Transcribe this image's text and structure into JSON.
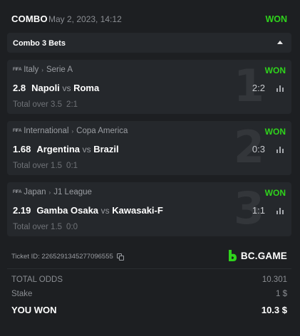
{
  "header": {
    "title": "COMBO",
    "date": "May 2, 2023, 14:12",
    "status": "WON",
    "status_color": "#2fd31c"
  },
  "combo_bar": {
    "label": "Combo 3 Bets",
    "toggle_icon": "caret-up-icon"
  },
  "bets": [
    {
      "index": "1",
      "sport_icon": "FIFA",
      "country": "Italy",
      "league": "Serie A",
      "status": "WON",
      "odd": "2.8",
      "home": "Napoli",
      "vs": "vs",
      "away": "Roma",
      "score": "2:2",
      "pick": "Total over 3.5",
      "pick_score": "2:1"
    },
    {
      "index": "2",
      "sport_icon": "FIFA",
      "country": "International",
      "league": "Copa America",
      "status": "WON",
      "odd": "1.68",
      "home": "Argentina",
      "vs": "vs",
      "away": "Brazil",
      "score": "0:3",
      "pick": "Total over 1.5",
      "pick_score": "0:1"
    },
    {
      "index": "3",
      "sport_icon": "FIFA",
      "country": "Japan",
      "league": "J1 League",
      "status": "WON",
      "odd": "2.19",
      "home": "Gamba Osaka",
      "vs": "vs",
      "away": "Kawasaki-F",
      "score": "1:1",
      "pick": "Total over 1.5",
      "pick_score": "0:0"
    }
  ],
  "ticket": {
    "label": "Ticket ID: 2265291345277096555",
    "copy_icon": "copy-icon"
  },
  "brand": {
    "name": "BC.GAME",
    "logo_color": "#2fd31c"
  },
  "summary": {
    "total_odds_label": "TOTAL ODDS",
    "total_odds_value": "10.301",
    "stake_label": "Stake",
    "stake_value": "1 $",
    "won_label": "YOU WON",
    "won_value": "10.3 $"
  }
}
